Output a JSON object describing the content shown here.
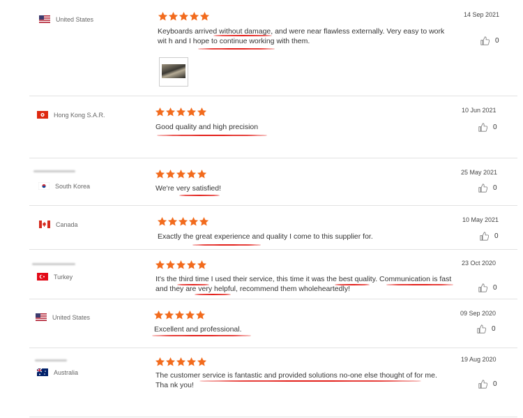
{
  "colors": {
    "star": "#f26b1d",
    "underline": "#e3201b",
    "divider": "#e2e2e2"
  },
  "reviews": [
    {
      "country": "United States",
      "flag": "us-flag-icon",
      "date": "14 Sep 2021",
      "text": "Keyboards arrived without damage, and were near flawless externally. Very easy to work wit h and I hope to continue working with them.",
      "likes": "0",
      "rating": 5
    },
    {
      "country": "Hong Kong S.A.R.",
      "flag": "hk-flag-icon",
      "date": "10 Jun 2021",
      "text": "Good quality and high precision",
      "likes": "0",
      "rating": 5
    },
    {
      "country": "South Korea",
      "flag": "kr-flag-icon",
      "date": "25 May 2021",
      "text": "We're very satisfied!",
      "likes": "0",
      "rating": 5
    },
    {
      "country": "Canada",
      "flag": "ca-flag-icon",
      "date": "10 May 2021",
      "text": "Exactly the great experience and quality I come to this supplier for.",
      "likes": "0",
      "rating": 5
    },
    {
      "country": "Turkey",
      "flag": "tr-flag-icon",
      "date": "23 Oct 2020",
      "text": "It's the third time I used their service, this time it was the best quality. Communication is fast and they are very helpful, recommend them wholeheartedly!",
      "likes": "0",
      "rating": 5
    },
    {
      "country": "United States",
      "flag": "us-flag-icon",
      "date": "09 Sep 2020",
      "text": "Excellent and professional.",
      "likes": "0",
      "rating": 5
    },
    {
      "country": "Australia",
      "flag": "au-flag-icon",
      "date": "19 Aug 2020",
      "text": "The customer service is fantastic and provided solutions no-one else thought of for me. Tha nk you!",
      "likes": "0",
      "rating": 5
    }
  ]
}
